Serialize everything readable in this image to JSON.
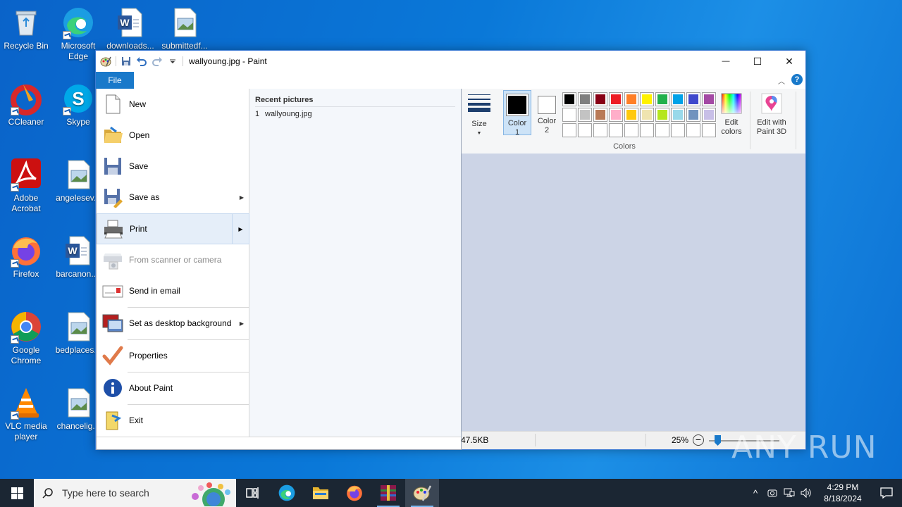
{
  "desktop": {
    "icons": [
      {
        "label": "Recycle Bin"
      },
      {
        "label": "Microsoft Edge"
      },
      {
        "label": "downloads..."
      },
      {
        "label": "submittedf..."
      },
      {
        "label": "CCleaner"
      },
      {
        "label": "Skype"
      },
      {
        "label": "Adobe Acrobat"
      },
      {
        "label": "angelesev..."
      },
      {
        "label": "Firefox"
      },
      {
        "label": "barcanon...."
      },
      {
        "label": "Google Chrome"
      },
      {
        "label": "bedplaces..."
      },
      {
        "label": "VLC media player"
      },
      {
        "label": "chancelig..."
      }
    ]
  },
  "window": {
    "title": "wallyoung.jpg - Paint",
    "controls": {
      "minimize": "—",
      "maximize": "☐",
      "close": "✕"
    }
  },
  "ribbon": {
    "file_tab": "File",
    "size_label": "Size",
    "color1_label": "Color 1",
    "color2_label": "Color 2",
    "colors_group_label": "Colors",
    "edit_colors_label": "Edit colors",
    "edit_paint3d_label": "Edit with Paint 3D",
    "palette_row1": [
      "#000000",
      "#7f7f7f",
      "#880015",
      "#ed1c24",
      "#ff7f27",
      "#fff200",
      "#22b14c",
      "#00a2e8",
      "#3f48cc",
      "#a349a4"
    ],
    "palette_row2": [
      "#ffffff",
      "#c3c3c3",
      "#b97a57",
      "#ffaec9",
      "#ffc90e",
      "#efe4b0",
      "#b5e61d",
      "#99d9ea",
      "#7092be",
      "#c8bfe7"
    ]
  },
  "file_menu": {
    "items": {
      "new": "New",
      "open": "Open",
      "save": "Save",
      "save_as": "Save as",
      "print": "Print",
      "scanner": "From scanner or camera",
      "email": "Send in email",
      "desktop_bg": "Set as desktop background",
      "properties": "Properties",
      "about": "About Paint",
      "exit": "Exit"
    },
    "recent_heading": "Recent pictures",
    "recent": [
      {
        "num": "1",
        "name": "wallyoung.jpg"
      }
    ]
  },
  "status": {
    "size": "47.5KB",
    "zoom": "25%"
  },
  "taskbar": {
    "search_placeholder": "Type here to search",
    "time": "4:29 PM",
    "date": "8/18/2024"
  },
  "watermark": "ANY RUN"
}
